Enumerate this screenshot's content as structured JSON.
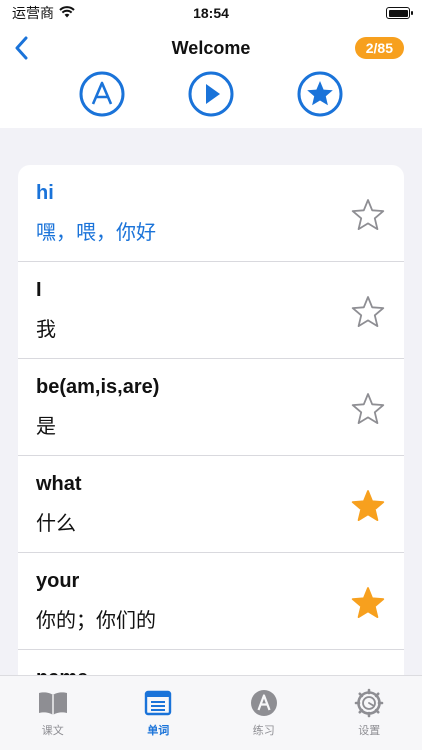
{
  "status": {
    "carrier": "运营商",
    "time": "18:54"
  },
  "nav": {
    "title": "Welcome",
    "progress_badge": "2/85"
  },
  "toolbar": {
    "buttons": [
      "letter-a-icon",
      "play-icon",
      "star-icon"
    ]
  },
  "words": [
    {
      "en": "hi",
      "zh": "嘿，喂，你好",
      "starred": false,
      "active": true
    },
    {
      "en": "I",
      "zh": "我",
      "starred": false,
      "active": false
    },
    {
      "en": "be(am,is,are)",
      "zh": "是",
      "starred": false,
      "active": false
    },
    {
      "en": "what",
      "zh": "什么",
      "starred": true,
      "active": false
    },
    {
      "en": "your",
      "zh": "你的；你们的",
      "starred": true,
      "active": false
    },
    {
      "en": "name",
      "zh": "",
      "starred": false,
      "active": false
    }
  ],
  "tabs": [
    {
      "label": "课文",
      "icon": "book-icon",
      "active": false
    },
    {
      "label": "单词",
      "icon": "vocabulary-icon",
      "active": true
    },
    {
      "label": "练习",
      "icon": "practice-icon",
      "active": false
    },
    {
      "label": "设置",
      "icon": "settings-icon",
      "active": false
    }
  ],
  "colors": {
    "accent": "#1a73d9",
    "badge": "#f7a01e",
    "star_filled": "#f7a01e",
    "star_empty": "#8e8e93"
  }
}
